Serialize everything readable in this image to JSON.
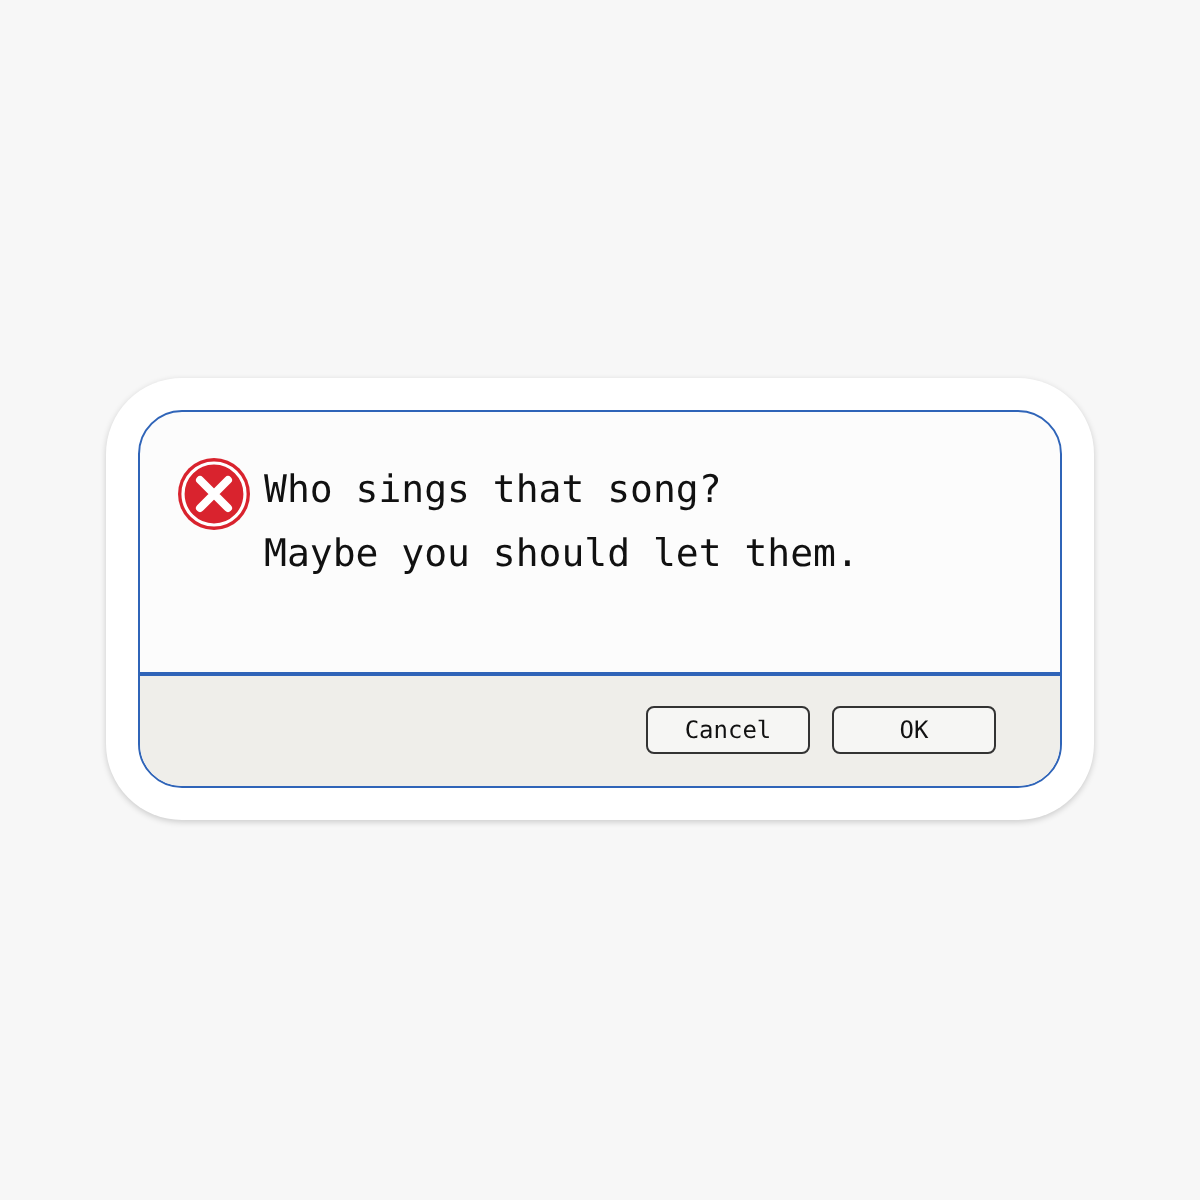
{
  "dialog": {
    "message_lines": [
      "Who sings that song?",
      "Maybe you should let them."
    ],
    "buttons": [
      {
        "label": "Cancel"
      },
      {
        "label": "OK"
      }
    ]
  }
}
